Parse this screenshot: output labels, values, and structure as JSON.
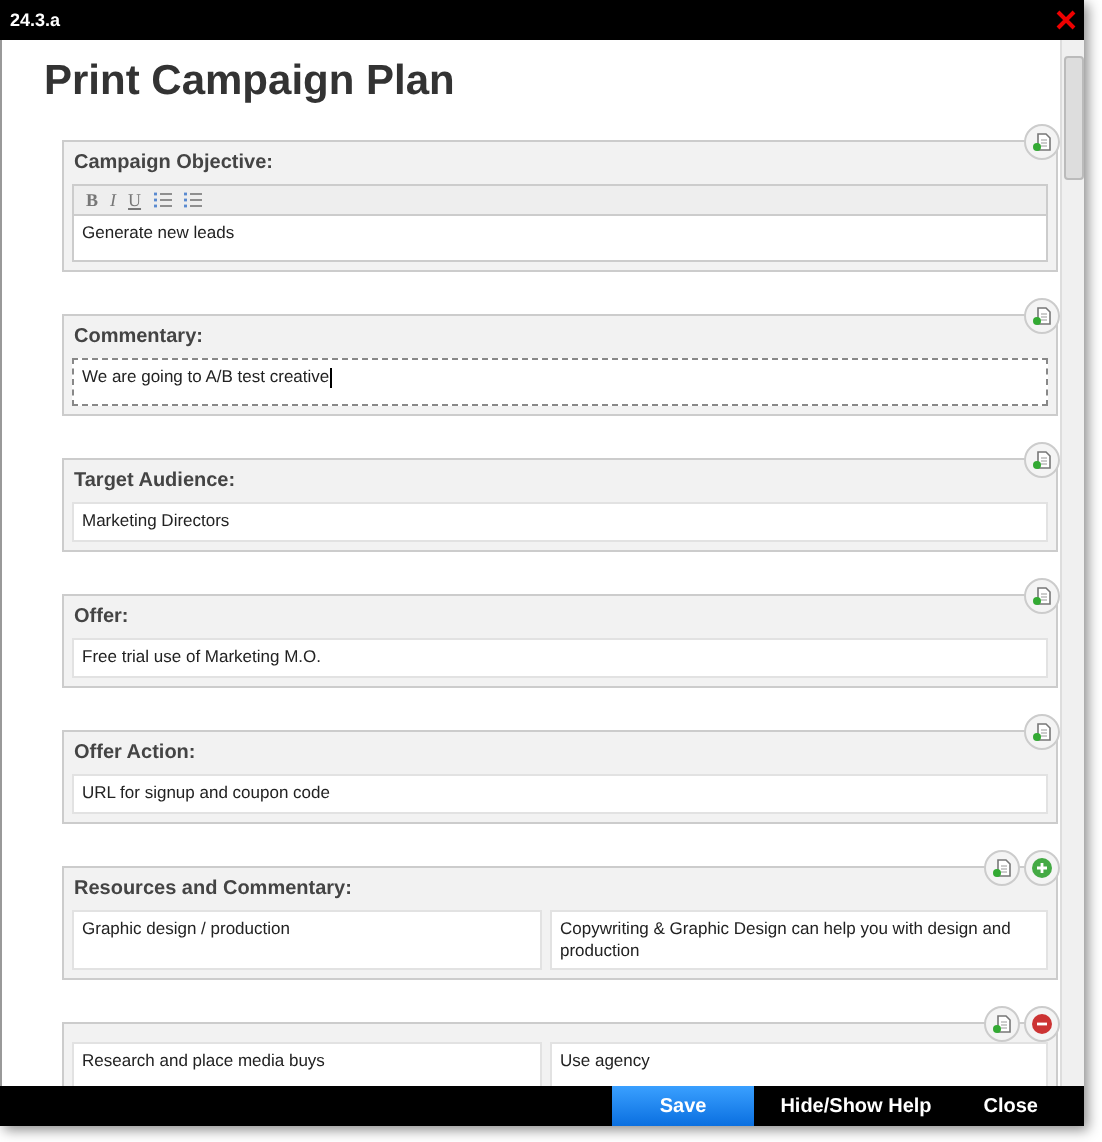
{
  "window": {
    "title": "24.3.a"
  },
  "heading": "Print Campaign Plan",
  "sections": [
    {
      "kind": "rich",
      "label": "Campaign Objective:",
      "toolbar": [
        "B",
        "I",
        "U"
      ],
      "value": "Generate new leads",
      "focused": false
    },
    {
      "kind": "text",
      "label": "Commentary:",
      "value": "We are going to A/B test creative",
      "focused": true
    },
    {
      "kind": "text",
      "label": "Target Audience:",
      "value": "Marketing Directors",
      "focused": false
    },
    {
      "kind": "text",
      "label": "Offer:",
      "value": "Free trial use of Marketing M.O.",
      "focused": false
    },
    {
      "kind": "text",
      "label": "Offer Action:",
      "value": "URL for signup and coupon code",
      "focused": false
    },
    {
      "kind": "pair",
      "label": "Resources and Commentary:",
      "left": "Graphic design / production",
      "right": "Copywriting & Graphic Design can help you with design and production",
      "can_add": true,
      "can_remove": false
    },
    {
      "kind": "pair",
      "left": "Research and place media buys",
      "right": "Use agency",
      "can_add": false,
      "can_remove": true
    }
  ],
  "footer": [
    {
      "label": "Save",
      "primary": true
    },
    {
      "label": "Hide/Show Help",
      "primary": false
    },
    {
      "label": "Close",
      "primary": false
    }
  ]
}
